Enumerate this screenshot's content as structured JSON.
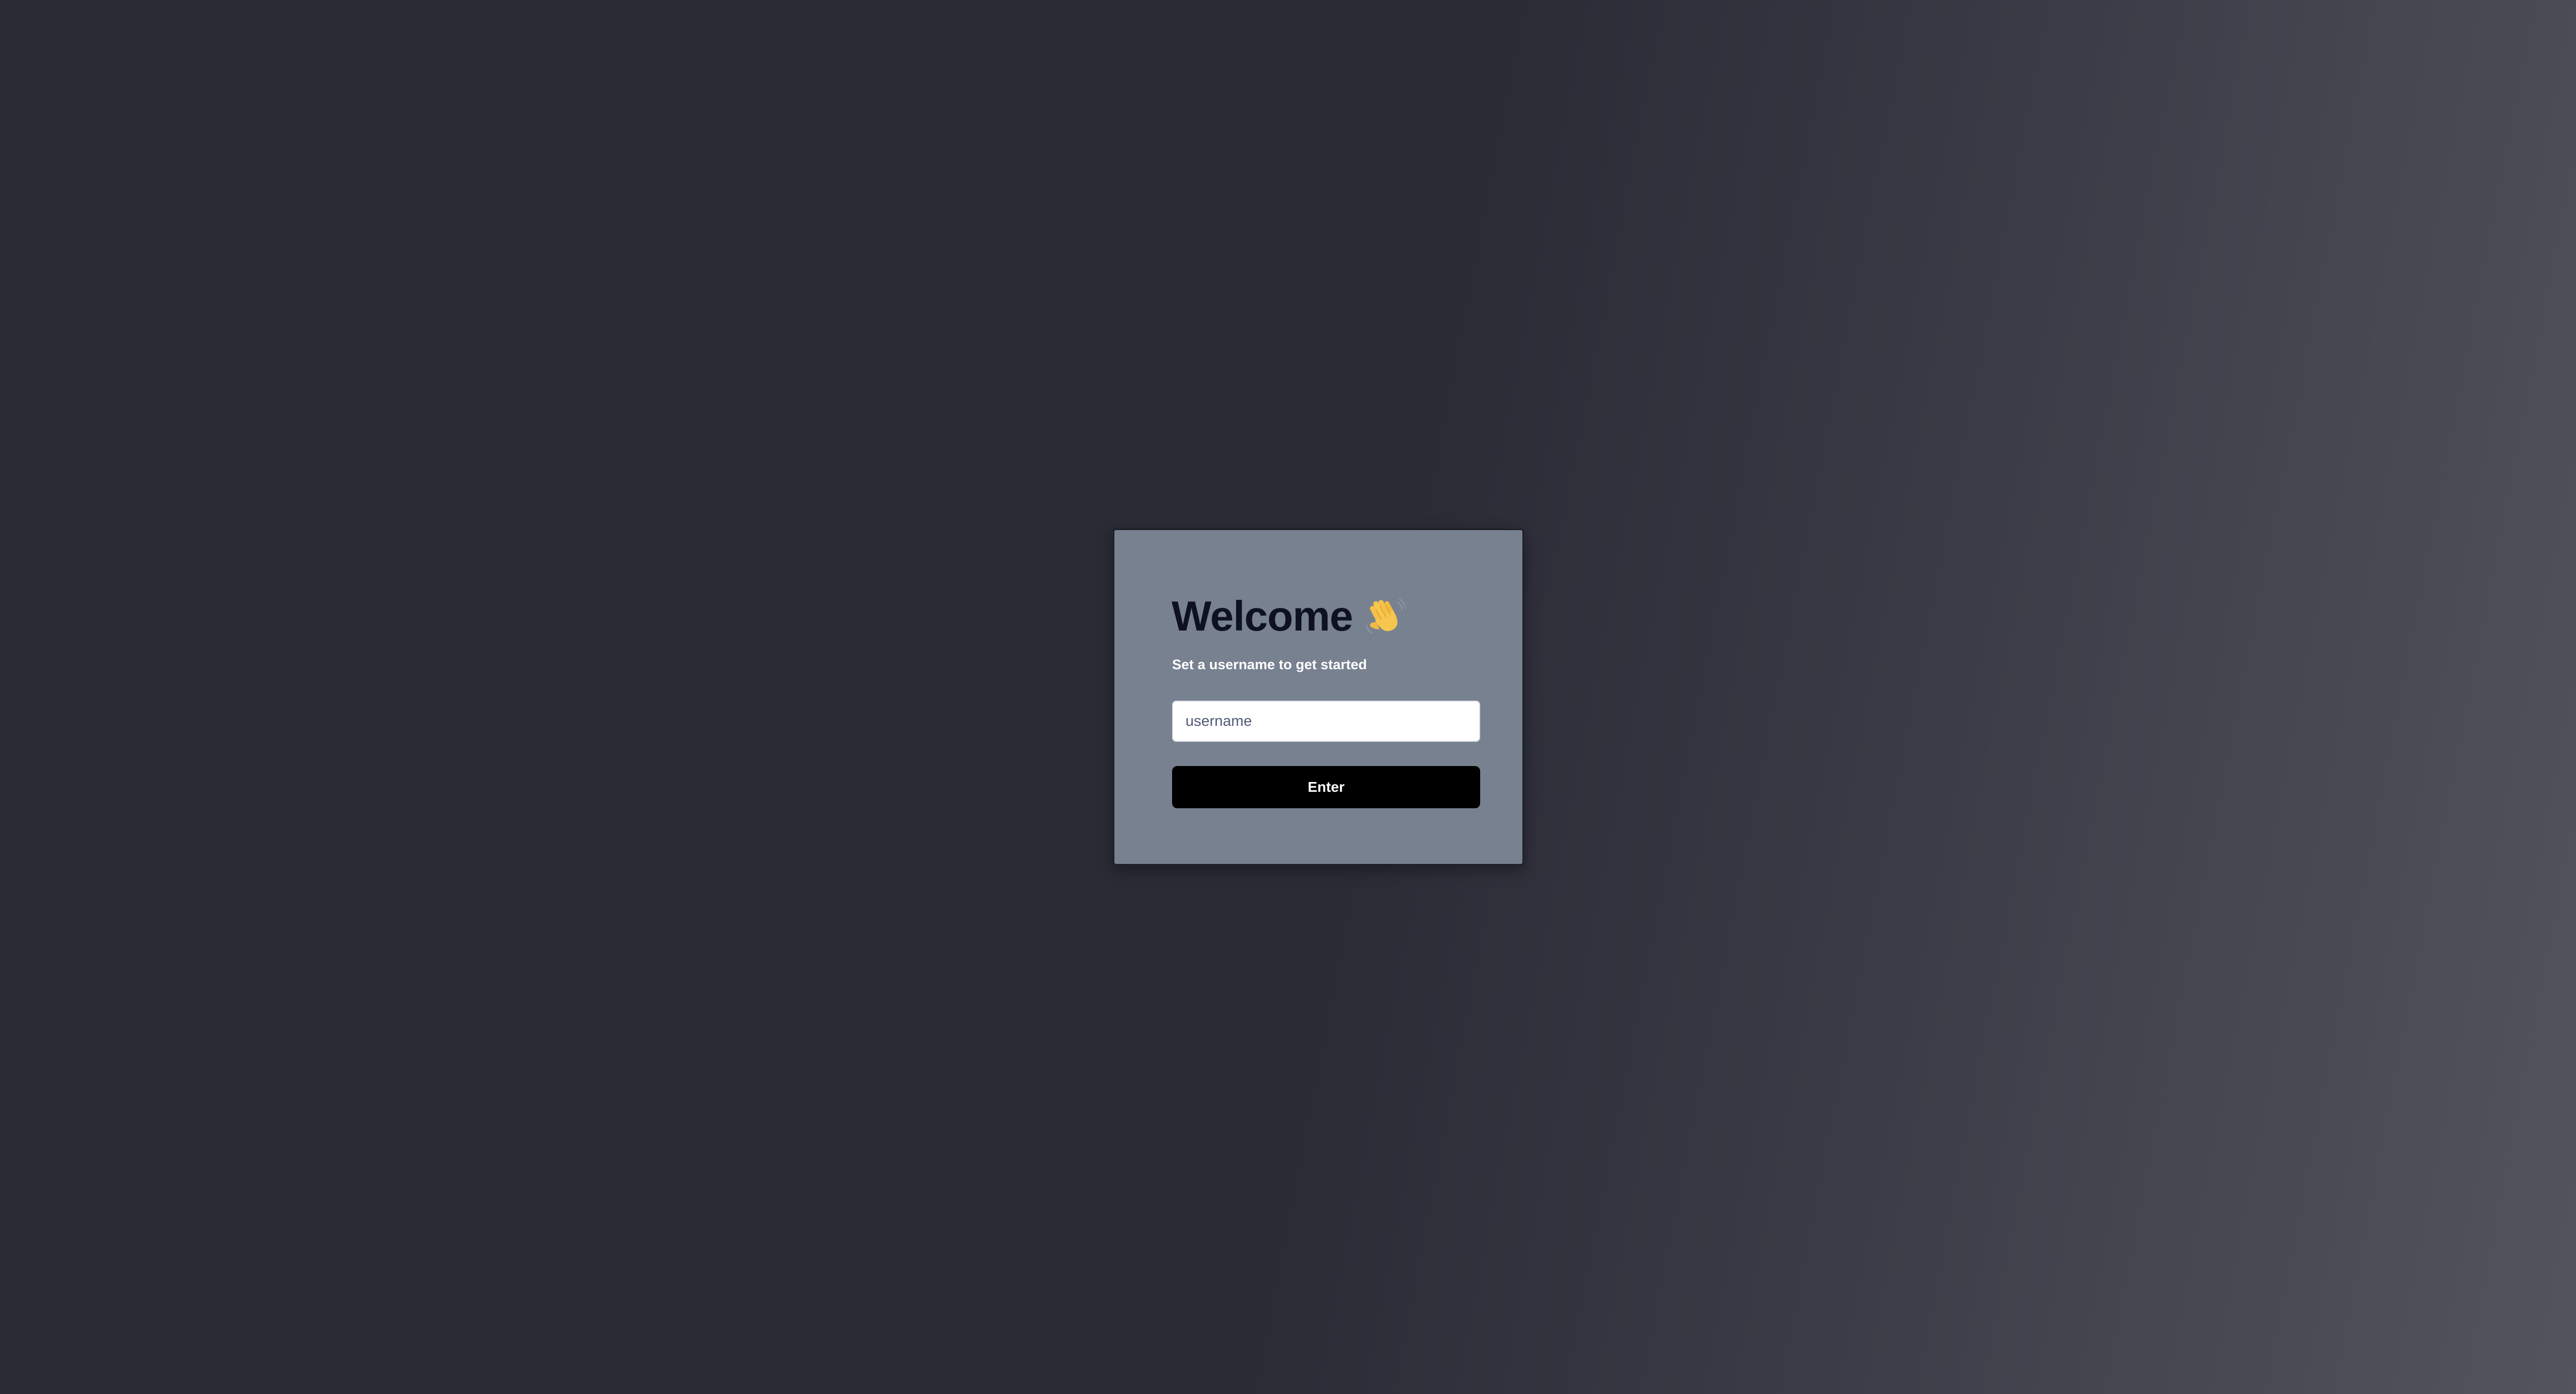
{
  "card": {
    "title": "Welcome",
    "title_emoji": "waving-hand-icon",
    "subtitle": "Set a username to get started",
    "username_input": {
      "placeholder": "username",
      "value": ""
    },
    "submit_label": "Enter"
  },
  "colors": {
    "background_dark": "#2a2b35",
    "background_light": "#55565d",
    "card_bg": "#778190",
    "title_text": "#0d1120",
    "button_bg": "#000000",
    "button_text": "#ffffff"
  }
}
